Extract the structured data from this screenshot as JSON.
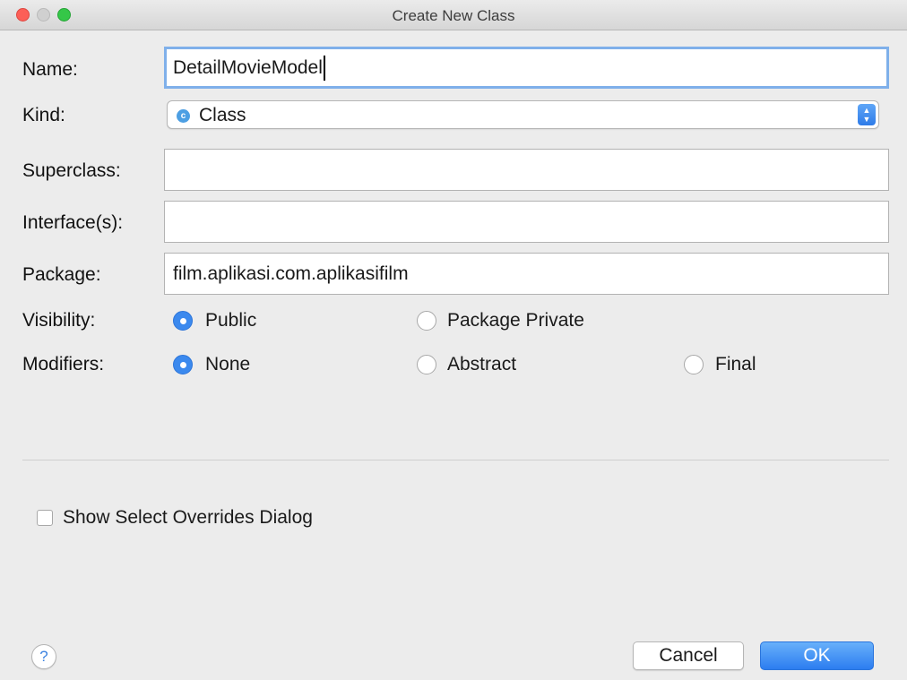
{
  "window": {
    "title": "Create New Class"
  },
  "form": {
    "name_label": "Name:",
    "name_value": "DetailMovieModel",
    "kind_label": "Kind:",
    "kind_value": "Class",
    "kind_icon": "class-c-icon",
    "superclass_label": "Superclass:",
    "superclass_value": "",
    "interfaces_label": "Interface(s):",
    "interfaces_value": "",
    "package_label": "Package:",
    "package_value": "film.aplikasi.com.aplikasifilm",
    "visibility_label": "Visibility:",
    "visibility_options": [
      {
        "label": "Public",
        "selected": true
      },
      {
        "label": "Package Private",
        "selected": false
      }
    ],
    "modifiers_label": "Modifiers:",
    "modifiers_options": [
      {
        "label": "None",
        "selected": true
      },
      {
        "label": "Abstract",
        "selected": false
      },
      {
        "label": "Final",
        "selected": false
      }
    ],
    "show_overrides_label": "Show Select Overrides Dialog",
    "show_overrides_checked": false
  },
  "footer": {
    "help_label": "?",
    "cancel_label": "Cancel",
    "ok_label": "OK"
  },
  "colors": {
    "accent": "#3b89ee",
    "close": "#fc5f57",
    "maximize": "#35c748"
  }
}
